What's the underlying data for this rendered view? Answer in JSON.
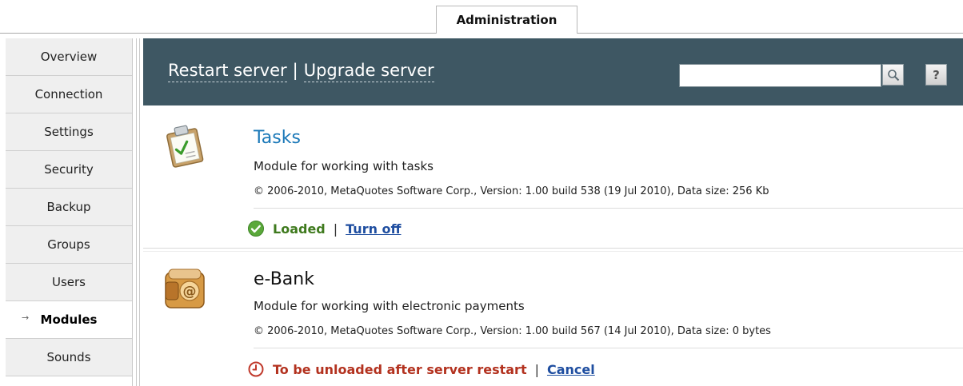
{
  "tabs": {
    "active": "Administration"
  },
  "sidebar": {
    "items": [
      {
        "label": "Overview"
      },
      {
        "label": "Connection"
      },
      {
        "label": "Settings"
      },
      {
        "label": "Security"
      },
      {
        "label": "Backup"
      },
      {
        "label": "Groups"
      },
      {
        "label": "Users"
      },
      {
        "label": "Modules",
        "active": true
      },
      {
        "label": "Sounds"
      }
    ],
    "active_marker": "→"
  },
  "header": {
    "restart_label": "Restart server",
    "separator": "|",
    "upgrade_label": "Upgrade server",
    "search_value": "",
    "help_label": "?"
  },
  "modules": [
    {
      "name": "Tasks",
      "description": "Module for working with tasks",
      "meta": "© 2006-2010, MetaQuotes Software Corp.,  Version: 1.00 build 538 (19 Jul 2010), Data size: 256 Kb",
      "status": "Loaded",
      "status_color": "#3f7a1e",
      "action": "Turn off",
      "icon": "clipboard-check-icon",
      "title_color": "#1a78b8"
    },
    {
      "name": "e-Bank",
      "description": "Module for working with electronic payments",
      "meta": "© 2006-2010, MetaQuotes Software Corp.,  Version: 1.00 build 567 (14 Jul 2010), Data size: 0 bytes",
      "status": "To be unloaded after server restart",
      "status_color": "#b3321f",
      "action": "Cancel",
      "icon": "wallet-at-icon",
      "title_color": "#111111"
    }
  ],
  "status_separator": "|"
}
